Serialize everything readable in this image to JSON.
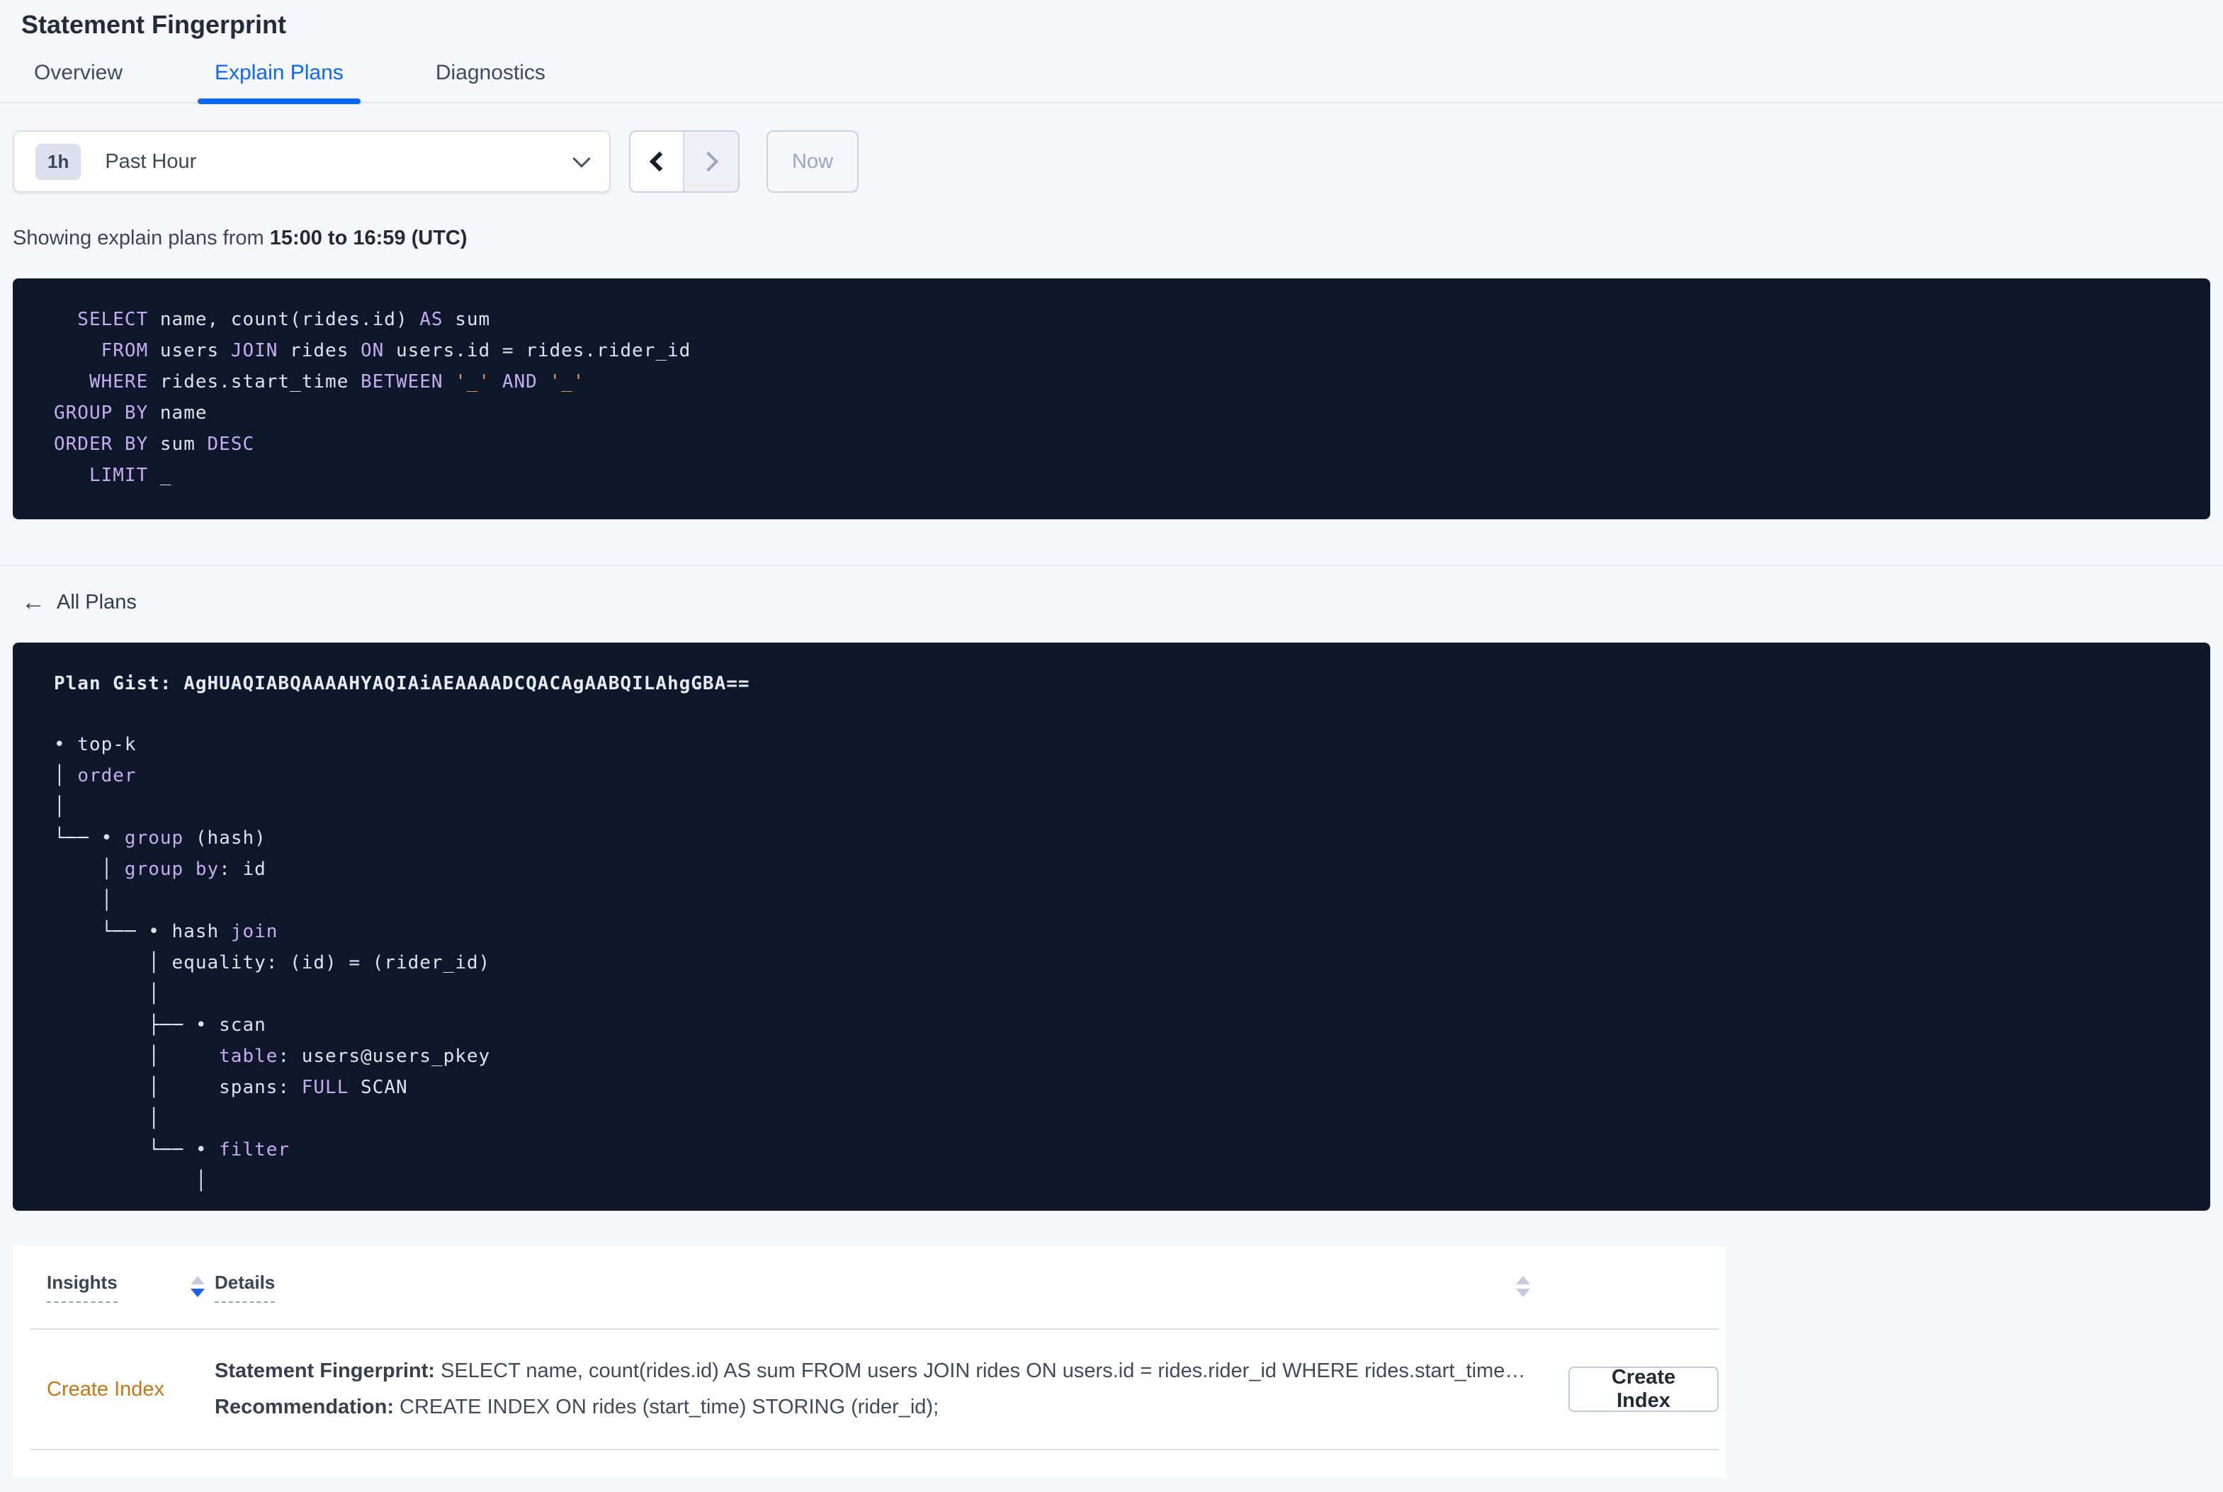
{
  "page": {
    "title": "Statement Fingerprint"
  },
  "tabs": [
    {
      "label": "Overview",
      "active": false
    },
    {
      "label": "Explain Plans",
      "active": true
    },
    {
      "label": "Diagnostics",
      "active": false
    }
  ],
  "time_picker": {
    "badge": "1h",
    "selected": "Past Hour",
    "prev_icon": "chevron-left",
    "next_icon": "chevron-right",
    "now_label": "Now"
  },
  "showing": {
    "prefix": "Showing explain plans from ",
    "range": "15:00 to 16:59 (UTC)"
  },
  "sql": {
    "lines": [
      [
        {
          "c": "kw",
          "t": "  SELECT"
        },
        {
          "c": "pl",
          "t": " name, count(rides.id) "
        },
        {
          "c": "kw",
          "t": "AS"
        },
        {
          "c": "pl",
          "t": " sum"
        }
      ],
      [
        {
          "c": "kw",
          "t": "    FROM"
        },
        {
          "c": "pl",
          "t": " users "
        },
        {
          "c": "kw",
          "t": "JOIN"
        },
        {
          "c": "pl",
          "t": " rides "
        },
        {
          "c": "kw",
          "t": "ON"
        },
        {
          "c": "pl",
          "t": " users.id = rides.rider_id"
        }
      ],
      [
        {
          "c": "kw",
          "t": "   WHERE"
        },
        {
          "c": "pl",
          "t": " rides.start_time "
        },
        {
          "c": "kw",
          "t": "BETWEEN"
        },
        {
          "c": "pl",
          "t": " "
        },
        {
          "c": "lit",
          "t": "'_'"
        },
        {
          "c": "pl",
          "t": " "
        },
        {
          "c": "kw",
          "t": "AND"
        },
        {
          "c": "pl",
          "t": " "
        },
        {
          "c": "lit",
          "t": "'_'"
        }
      ],
      [
        {
          "c": "kw",
          "t": "GROUP BY"
        },
        {
          "c": "pl",
          "t": " name"
        }
      ],
      [
        {
          "c": "kw",
          "t": "ORDER BY"
        },
        {
          "c": "pl",
          "t": " sum "
        },
        {
          "c": "kw",
          "t": "DESC"
        }
      ],
      [
        {
          "c": "kw",
          "t": "   LIMIT"
        },
        {
          "c": "pl",
          "t": " _"
        }
      ]
    ]
  },
  "all_plans": {
    "label": "All Plans",
    "arrow": "←"
  },
  "plan": {
    "gist_label": "Plan Gist: ",
    "gist": "AgHUAQIABQAAAAHYAQIAiAEAAAADCQACAgAABQILAhgGBA==",
    "tree_lines": [
      [
        {
          "c": "pl",
          "t": "• top-k"
        }
      ],
      [
        {
          "c": "pl",
          "t": "│ "
        },
        {
          "c": "kw",
          "t": "order"
        }
      ],
      [
        {
          "c": "pl",
          "t": "│"
        }
      ],
      [
        {
          "c": "pl",
          "t": "└── • "
        },
        {
          "c": "kw",
          "t": "group"
        },
        {
          "c": "pl",
          "t": " (hash)"
        }
      ],
      [
        {
          "c": "pl",
          "t": "    │ "
        },
        {
          "c": "kw",
          "t": "group by"
        },
        {
          "c": "pl",
          "t": ": id"
        }
      ],
      [
        {
          "c": "pl",
          "t": "    │"
        }
      ],
      [
        {
          "c": "pl",
          "t": "    └── • hash "
        },
        {
          "c": "kw",
          "t": "join"
        }
      ],
      [
        {
          "c": "pl",
          "t": "        │ equality: (id) = (rider_id)"
        }
      ],
      [
        {
          "c": "pl",
          "t": "        │"
        }
      ],
      [
        {
          "c": "pl",
          "t": "        ├── • scan"
        }
      ],
      [
        {
          "c": "pl",
          "t": "        │     "
        },
        {
          "c": "kw",
          "t": "table"
        },
        {
          "c": "pl",
          "t": ": users@users_pkey"
        }
      ],
      [
        {
          "c": "pl",
          "t": "        │     spans: "
        },
        {
          "c": "kw",
          "t": "FULL"
        },
        {
          "c": "pl",
          "t": " SCAN"
        }
      ],
      [
        {
          "c": "pl",
          "t": "        │"
        }
      ],
      [
        {
          "c": "pl",
          "t": "        └── • "
        },
        {
          "c": "kw",
          "t": "filter"
        }
      ],
      [
        {
          "c": "pl",
          "t": "            │"
        }
      ]
    ]
  },
  "insights_table": {
    "columns": {
      "insights": "Insights",
      "details": "Details"
    },
    "row": {
      "insight": "Create Index",
      "statement_label": "Statement Fingerprint:",
      "statement": " SELECT name, count(rides.id) AS sum FROM users JOIN rides ON users.id = rides.rider_id WHERE rides.start_time BETWEEN '_' AND '_' GROUP BY name ORDER BY sum DESC LIMIT _",
      "recommendation_label": "Recommendation:",
      "recommendation": " CREATE INDEX ON rides (start_time) STORING (rider_id);",
      "action": "Create Index"
    }
  },
  "colors": {
    "accent_blue": "#0a66ff",
    "page_bg": "#f5f7fa",
    "code_bg": "#0f182b",
    "code_keyword": "#c5abef",
    "code_plain": "#dde3ee",
    "code_literal": "#e8943c",
    "insight_link": "#c97512",
    "sort_active": "#1b5fff"
  }
}
